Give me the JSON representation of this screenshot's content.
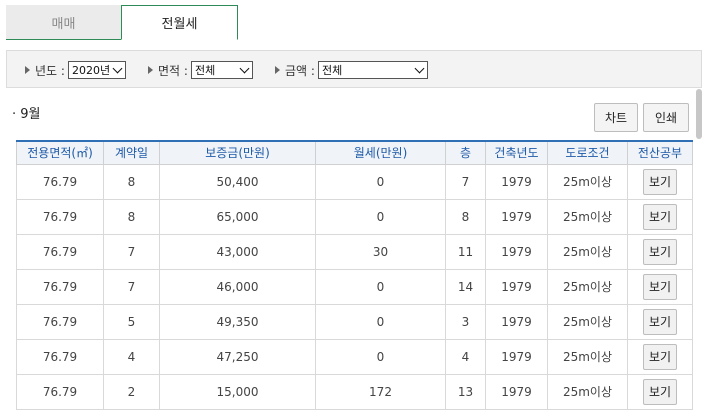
{
  "tabs": {
    "sale": "매매",
    "rent": "전월세"
  },
  "filters": {
    "year": {
      "label": "년도 :",
      "value": "2020년"
    },
    "area": {
      "label": "면적 :",
      "value": "전체"
    },
    "price": {
      "label": "금액 :",
      "value": "전체"
    }
  },
  "month_label": "· 9월",
  "buttons": {
    "chart": "차트",
    "print": "인쇄"
  },
  "table": {
    "headers": [
      "전용면적(㎡)",
      "계약일",
      "보증금(만원)",
      "월세(만원)",
      "층",
      "건축년도",
      "도로조건",
      "전산공부"
    ],
    "rows": [
      [
        "76.79",
        "8",
        "50,400",
        "0",
        "7",
        "1979",
        "25m이상",
        "보기"
      ],
      [
        "76.79",
        "8",
        "65,000",
        "0",
        "8",
        "1979",
        "25m이상",
        "보기"
      ],
      [
        "76.79",
        "7",
        "43,000",
        "30",
        "11",
        "1979",
        "25m이상",
        "보기"
      ],
      [
        "76.79",
        "7",
        "46,000",
        "0",
        "14",
        "1979",
        "25m이상",
        "보기"
      ],
      [
        "76.79",
        "5",
        "49,350",
        "0",
        "3",
        "1979",
        "25m이상",
        "보기"
      ],
      [
        "76.79",
        "4",
        "47,250",
        "0",
        "4",
        "1979",
        "25m이상",
        "보기"
      ],
      [
        "76.79",
        "2",
        "15,000",
        "172",
        "13",
        "1979",
        "25m이상",
        "보기"
      ]
    ]
  },
  "colors": {
    "accent_green": "#2e8b57",
    "header_blue": "#1e5aa8",
    "header_border": "#2e6fb5"
  }
}
